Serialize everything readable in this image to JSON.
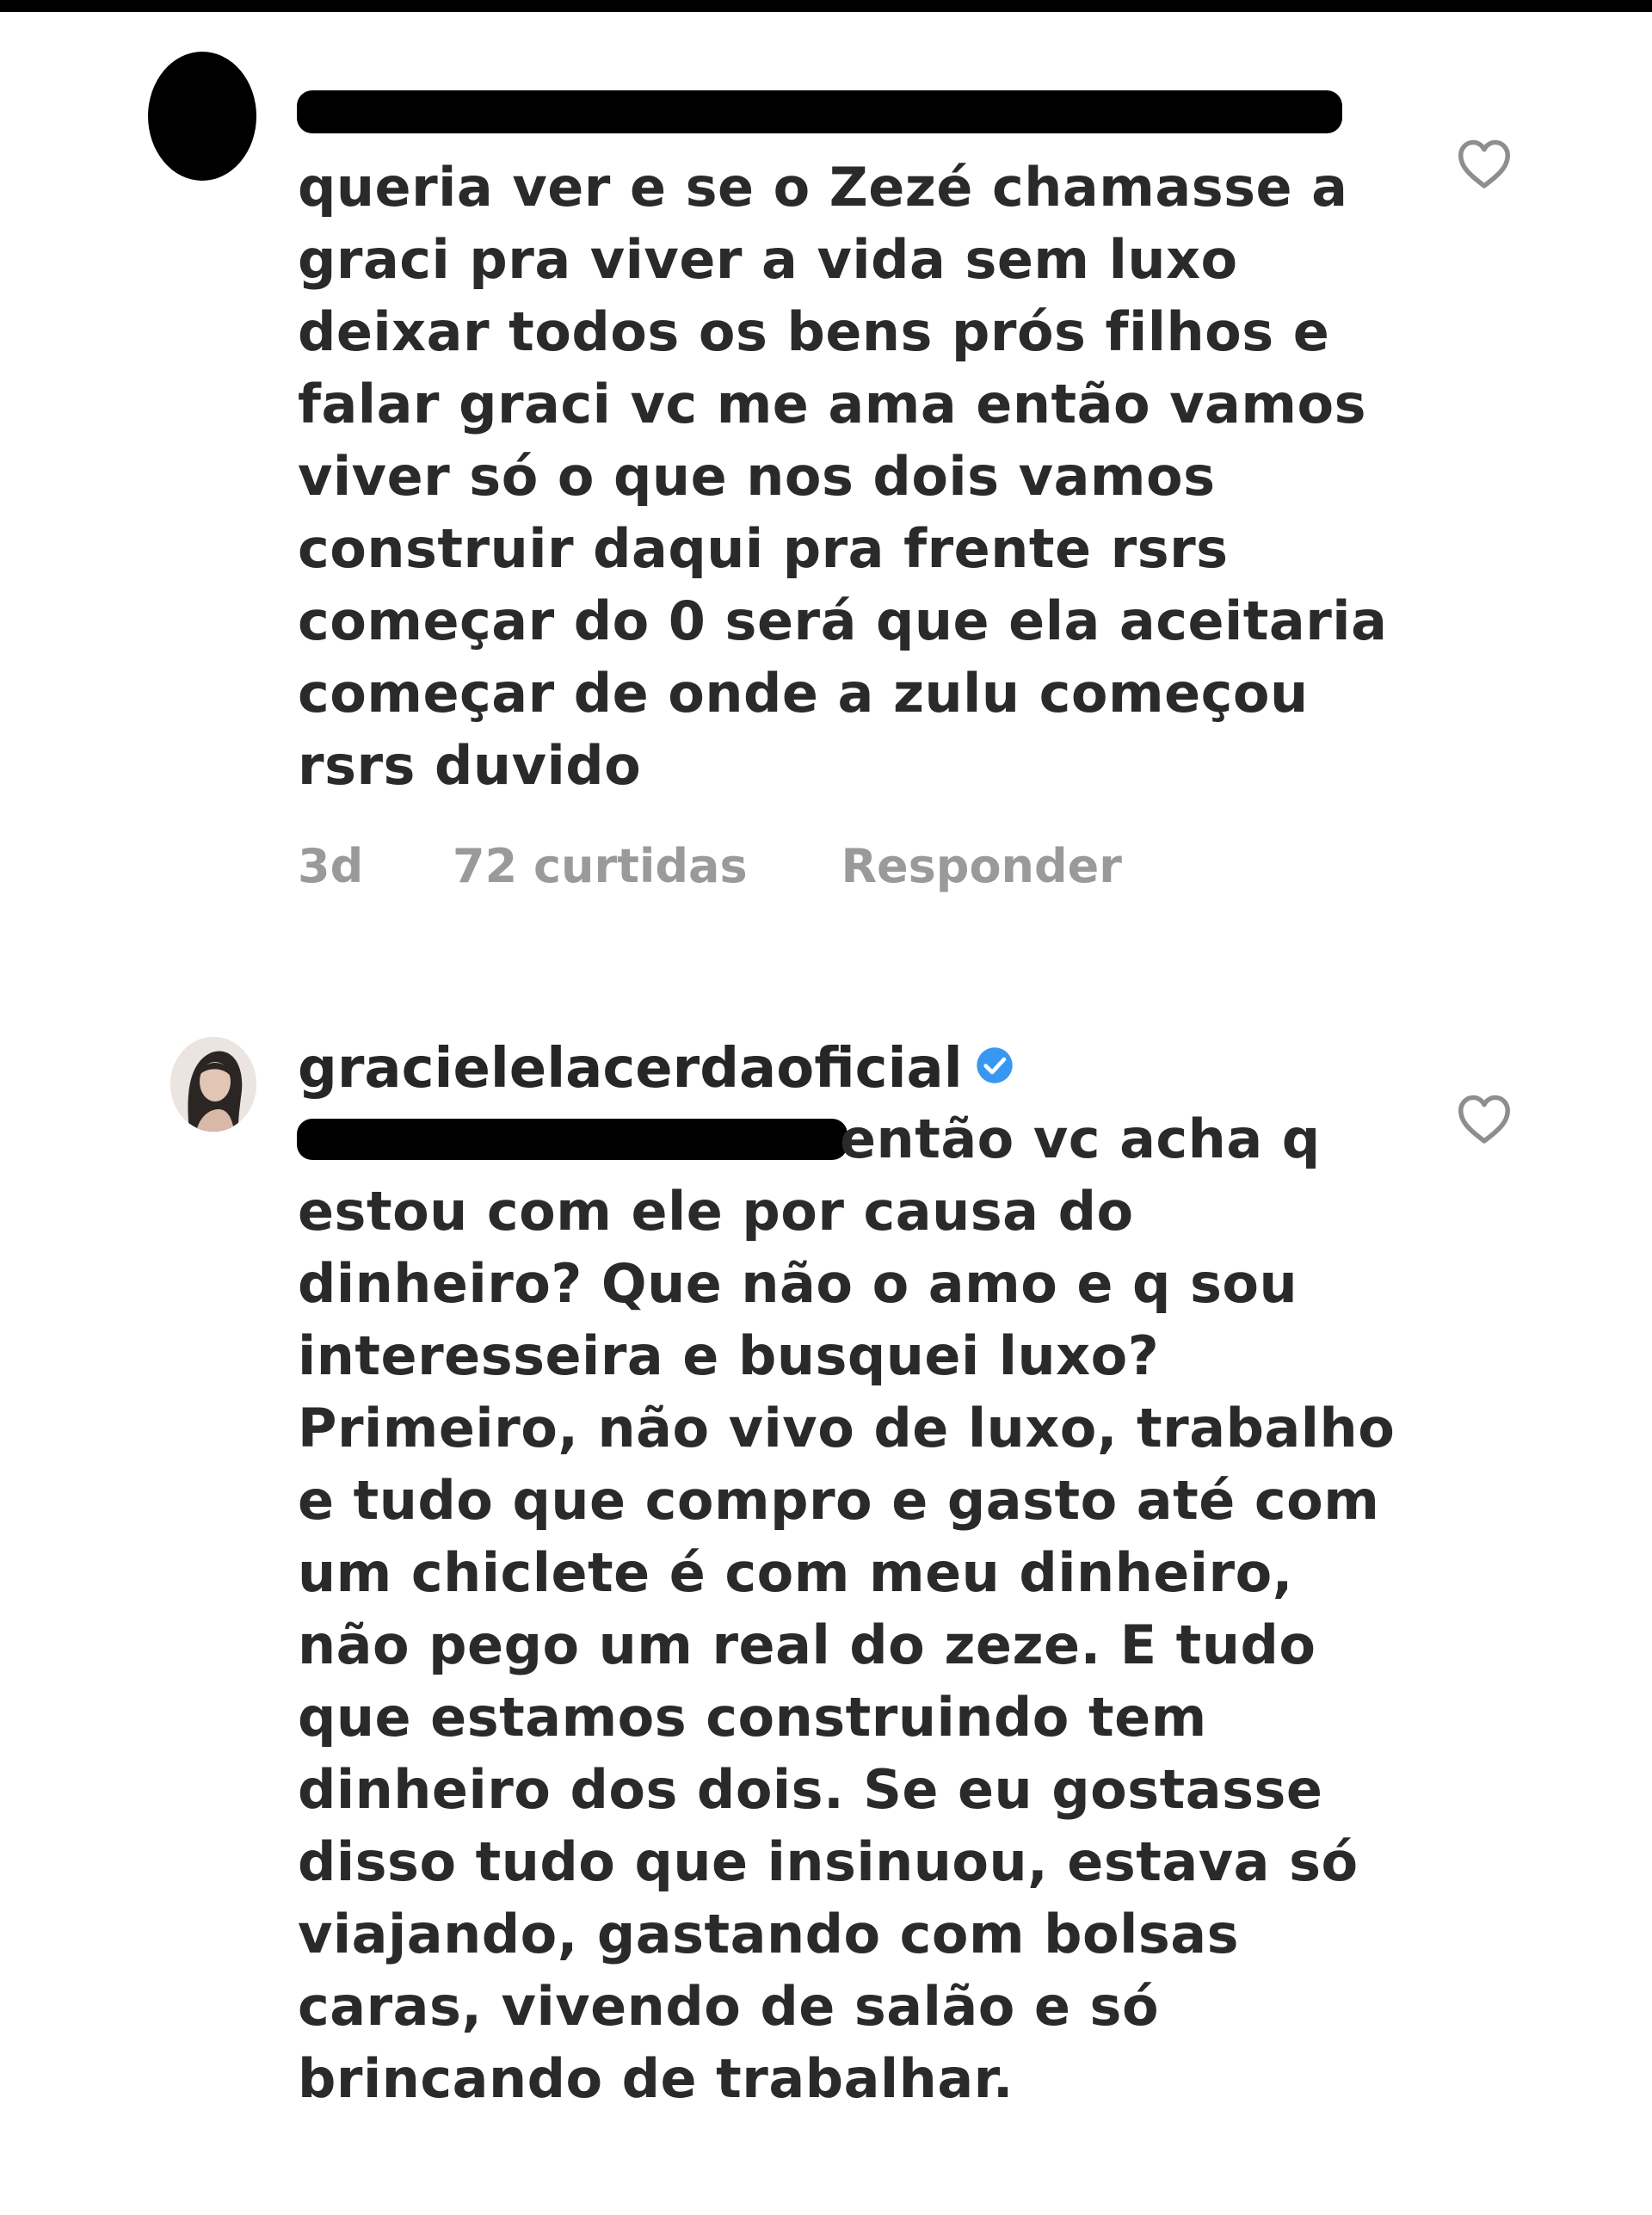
{
  "comment_1": {
    "text_lines": [
      "queria ver e se o Zezé chamasse a",
      "graci pra viver a vida sem luxo",
      "deixar todos os bens prós filhos e",
      "falar graci vc me ama então vamos",
      "viver só o que nos dois vamos",
      "construir daqui pra frente rsrs",
      "começar do 0 será que ela aceitaria",
      "começar de onde a zulu começou",
      "rsrs duvido"
    ],
    "time": "3d",
    "likes": "72 curtidas",
    "reply_label": "Responder"
  },
  "comment_2": {
    "username": "gracielelacerdaoficial",
    "first_line": "então vc acha q",
    "text_lines": [
      "estou com ele por causa do",
      "dinheiro? Que não o amo e q sou",
      "interesseira e busquei luxo?",
      "Primeiro, não vivo de luxo, trabalho",
      "e tudo que compro e gasto até com",
      "um chiclete é com meu dinheiro,",
      "não pego um real do zeze. E tudo",
      "que estamos construindo tem",
      "dinheiro dos dois. Se eu gostasse",
      "disso tudo que insinuou, estava só",
      "viajando, gastando com bolsas",
      "caras, vivendo de salão e só",
      "brincando de trabalhar."
    ]
  },
  "colors": {
    "text": "#262626",
    "meta": "#9a9a9a",
    "verified": "#3897f0",
    "redaction": "#000000"
  },
  "icons": {
    "like": "heart-outline-icon",
    "verified": "verified-badge-icon"
  }
}
